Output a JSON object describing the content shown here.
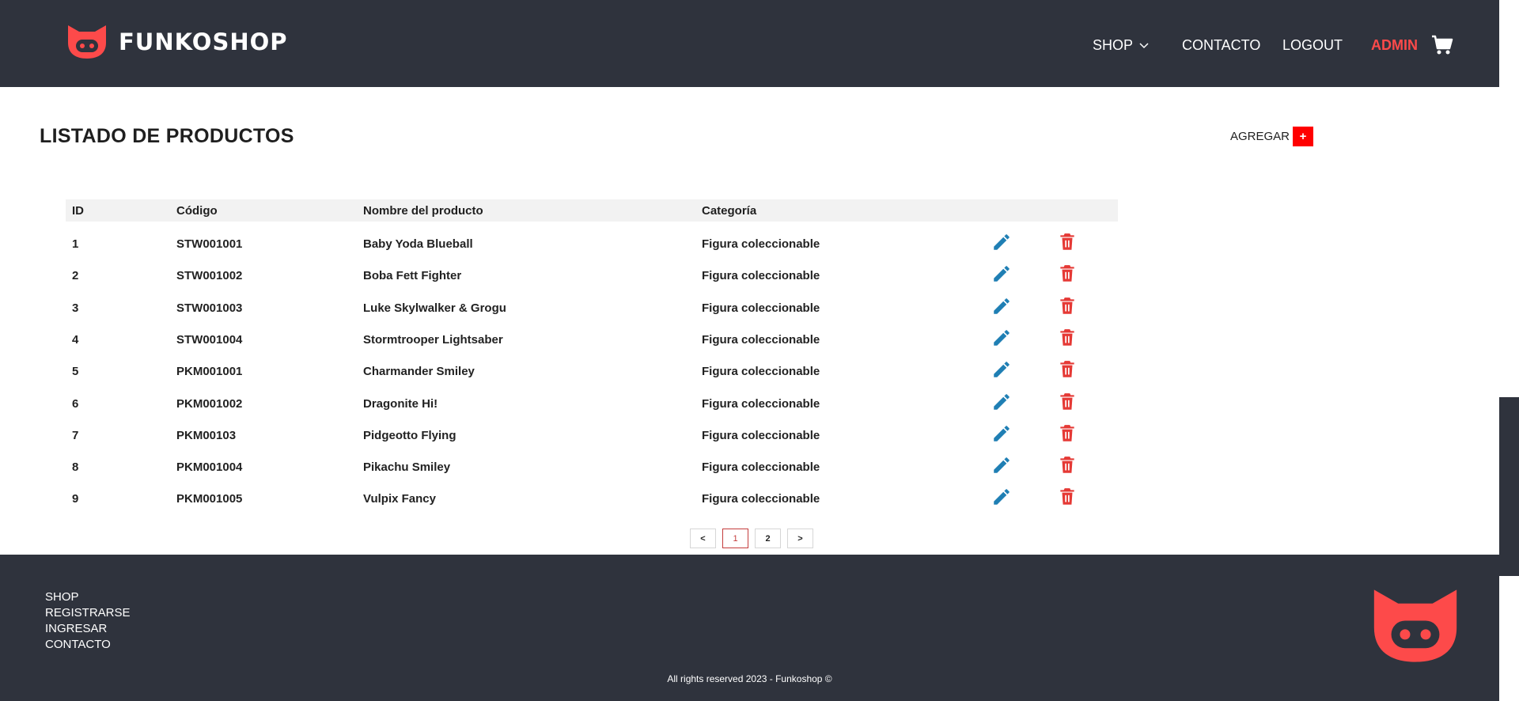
{
  "header": {
    "brand": "FUNKOSHOP",
    "nav": {
      "shop": "SHOP",
      "contact": "CONTACTO",
      "logout": "LOGOUT",
      "admin": "ADMIN"
    },
    "icons": [
      "logo-icon",
      "chevron-down-icon",
      "cart-icon"
    ]
  },
  "main": {
    "title": "LISTADO DE PRODUCTOS",
    "add_label": "AGREGAR",
    "add_button": "+",
    "columns": [
      "ID",
      "Código",
      "Nombre del producto",
      "Categoría"
    ],
    "rows": [
      {
        "id": "1",
        "code": "STW001001",
        "name": "Baby Yoda Blueball",
        "category": "Figura coleccionable"
      },
      {
        "id": "2",
        "code": "STW001002",
        "name": "Boba Fett Fighter",
        "category": "Figura coleccionable"
      },
      {
        "id": "3",
        "code": "STW001003",
        "name": "Luke Skylwalker & Grogu",
        "category": "Figura coleccionable"
      },
      {
        "id": "4",
        "code": "STW001004",
        "name": "Stormtrooper Lightsaber",
        "category": "Figura coleccionable"
      },
      {
        "id": "5",
        "code": "PKM001001",
        "name": "Charmander Smiley",
        "category": "Figura coleccionable"
      },
      {
        "id": "6",
        "code": "PKM001002",
        "name": "Dragonite Hi!",
        "category": "Figura coleccionable"
      },
      {
        "id": "7",
        "code": "PKM00103",
        "name": "Pidgeotto Flying",
        "category": "Figura coleccionable"
      },
      {
        "id": "8",
        "code": "PKM001004",
        "name": "Pikachu Smiley",
        "category": "Figura coleccionable"
      },
      {
        "id": "9",
        "code": "PKM001005",
        "name": "Vulpix Fancy",
        "category": "Figura coleccionable"
      }
    ],
    "row_icons": [
      "pencil-icon",
      "trash-icon"
    ],
    "pagination": {
      "prev": "<",
      "pages": [
        "1",
        "2"
      ],
      "current": "1",
      "next": ">"
    }
  },
  "footer": {
    "links": [
      "SHOP",
      "REGISTRARSE",
      "INGRESAR",
      "CONTACTO"
    ],
    "copyright": "All rights reserved 2023 - Funkoshop ©"
  },
  "colors": {
    "dark": "#2f333d",
    "accent_red": "#fd4a4a",
    "edit_blue": "#1f7fb4",
    "delete_red": "#e53935",
    "add_red": "#ff0000"
  }
}
